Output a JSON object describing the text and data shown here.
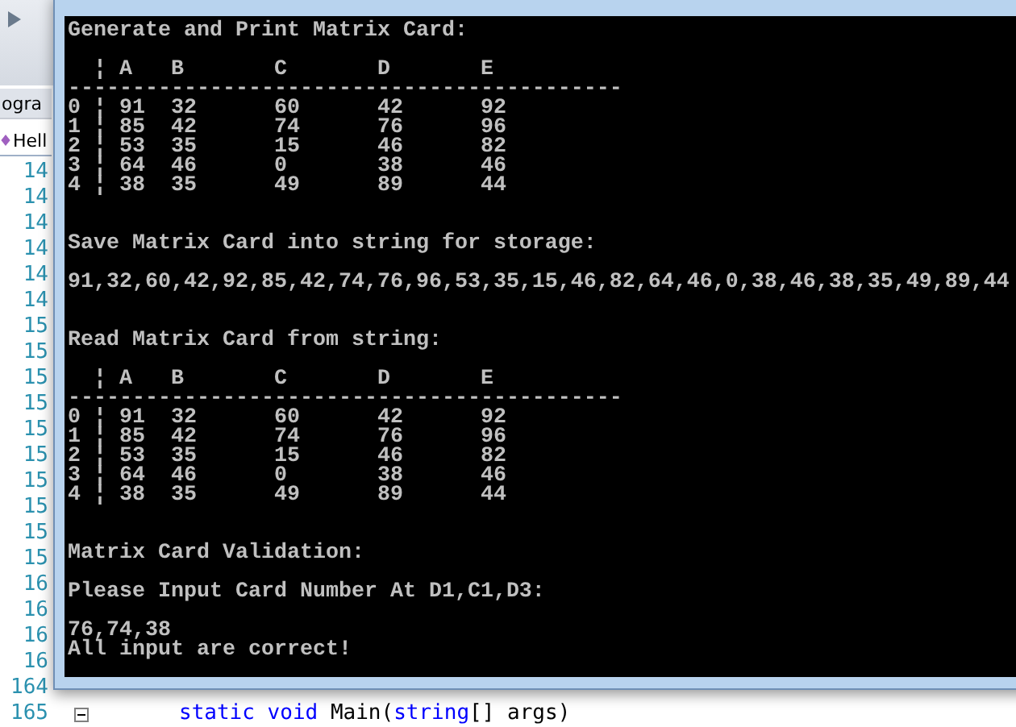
{
  "editor": {
    "tabs": [
      {
        "label": "ogra",
        "selected": false
      },
      {
        "label": "Hell",
        "selected": true
      }
    ],
    "line_numbers": [
      "14",
      "14",
      "14",
      "14",
      "14",
      "14",
      "15",
      "15",
      "15",
      "15",
      "15",
      "15",
      "15",
      "15",
      "15",
      "15",
      "16",
      "16",
      "16",
      "16"
    ],
    "code_lines": [
      {
        "number": "164",
        "collapsible": false
      },
      {
        "number": "165",
        "collapsible": true,
        "words": [
          [
            {
              "kind": "keyword",
              "text": "static"
            }
          ],
          [
            {
              "kind": "keyword",
              "text": "void"
            }
          ],
          [
            {
              "kind": "plain",
              "text": "Main("
            },
            {
              "kind": "keyword",
              "text": "string"
            },
            {
              "kind": "plain",
              "text": "[]"
            }
          ],
          [
            {
              "kind": "plain",
              "text": "args)"
            }
          ]
        ]
      }
    ]
  },
  "console": {
    "blocks": [
      {
        "kind": "text",
        "text": "Generate and Print Matrix Card:"
      },
      {
        "kind": "blank"
      },
      {
        "kind": "table",
        "separator": "¦",
        "rule": "-------------------------------------------",
        "columns": [
          "A",
          "B",
          "C",
          "D",
          "E"
        ],
        "rows": [
          {
            "label": "0",
            "cells": [
              "91",
              "32",
              "60",
              "42",
              "92"
            ]
          },
          {
            "label": "1",
            "cells": [
              "85",
              "42",
              "74",
              "76",
              "96"
            ]
          },
          {
            "label": "2",
            "cells": [
              "53",
              "35",
              "15",
              "46",
              "82"
            ]
          },
          {
            "label": "3",
            "cells": [
              "64",
              "46",
              "0",
              "38",
              "46"
            ]
          },
          {
            "label": "4",
            "cells": [
              "38",
              "35",
              "49",
              "89",
              "44"
            ]
          }
        ]
      },
      {
        "kind": "blank"
      },
      {
        "kind": "blank"
      },
      {
        "kind": "text",
        "text": "Save Matrix Card into string for storage:"
      },
      {
        "kind": "blank"
      },
      {
        "kind": "text",
        "text": "91,32,60,42,92,85,42,74,76,96,53,35,15,46,82,64,46,0,38,46,38,35,49,89,44"
      },
      {
        "kind": "blank"
      },
      {
        "kind": "blank"
      },
      {
        "kind": "text",
        "text": "Read Matrix Card from string:"
      },
      {
        "kind": "blank"
      },
      {
        "kind": "table",
        "separator": "¦",
        "rule": "-------------------------------------------",
        "columns": [
          "A",
          "B",
          "C",
          "D",
          "E"
        ],
        "rows": [
          {
            "label": "0",
            "cells": [
              "91",
              "32",
              "60",
              "42",
              "92"
            ]
          },
          {
            "label": "1",
            "cells": [
              "85",
              "42",
              "74",
              "76",
              "96"
            ]
          },
          {
            "label": "2",
            "cells": [
              "53",
              "35",
              "15",
              "46",
              "82"
            ]
          },
          {
            "label": "3",
            "cells": [
              "64",
              "46",
              "0",
              "38",
              "46"
            ]
          },
          {
            "label": "4",
            "cells": [
              "38",
              "35",
              "49",
              "89",
              "44"
            ]
          }
        ]
      },
      {
        "kind": "blank"
      },
      {
        "kind": "blank"
      },
      {
        "kind": "text",
        "text": "Matrix Card Validation:"
      },
      {
        "kind": "blank"
      },
      {
        "kind": "text",
        "text": "Please Input Card Number At D1,C1,D3:"
      },
      {
        "kind": "blank"
      },
      {
        "kind": "text",
        "text": "76,74,38"
      },
      {
        "kind": "text",
        "text": "All input are correct!"
      }
    ]
  }
}
